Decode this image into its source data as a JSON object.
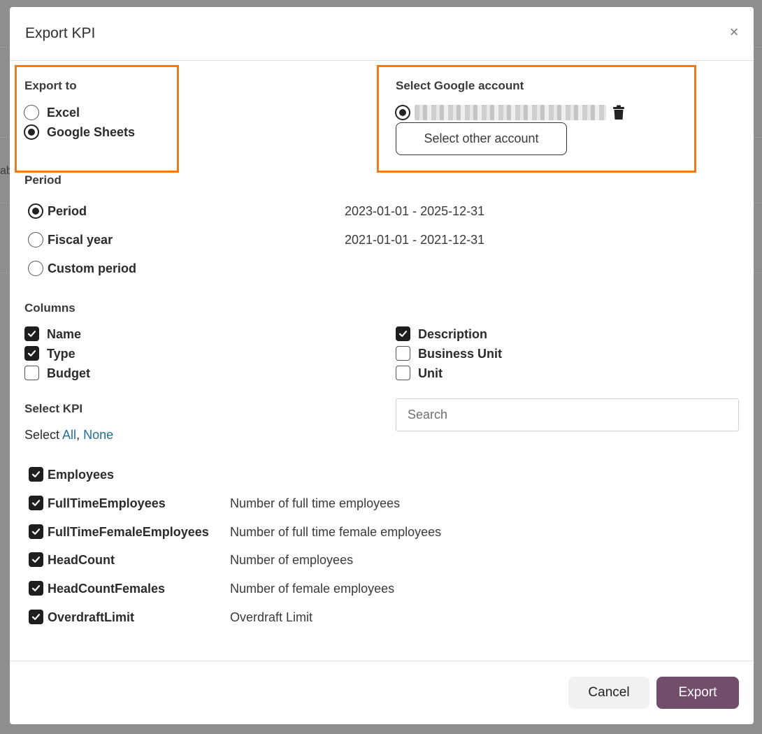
{
  "background": {
    "peek_text": "ab"
  },
  "modal": {
    "title": "Export KPI",
    "close_label": "×"
  },
  "export_to": {
    "title": "Export to",
    "options": [
      {
        "label": "Excel",
        "checked": false
      },
      {
        "label": "Google Sheets",
        "checked": true
      }
    ]
  },
  "google_account": {
    "title": "Select Google account",
    "account_checked": true,
    "trash_icon": "trash-icon",
    "other_account_label": "Select other account"
  },
  "period": {
    "title": "Period",
    "options": [
      {
        "label": "Period",
        "range": "2023-01-01 - 2025-12-31",
        "checked": true
      },
      {
        "label": "Fiscal year",
        "range": "2021-01-01 - 2021-12-31",
        "checked": false
      },
      {
        "label": "Custom period",
        "range": "",
        "checked": false
      }
    ]
  },
  "columns": {
    "title": "Columns",
    "left": [
      {
        "label": "Name",
        "checked": true
      },
      {
        "label": "Type",
        "checked": true
      },
      {
        "label": "Budget",
        "checked": false
      }
    ],
    "right": [
      {
        "label": "Description",
        "checked": true
      },
      {
        "label": "Business Unit",
        "checked": false
      },
      {
        "label": "Unit",
        "checked": false
      }
    ]
  },
  "select_kpi": {
    "title": "Select KPI",
    "select_prefix": "Select",
    "all_label": "All",
    "separator": ",",
    "none_label": "None",
    "search_placeholder": "Search",
    "items": [
      {
        "name": "Employees",
        "description": "",
        "checked": true
      },
      {
        "name": "FullTimeEmployees",
        "description": "Number of full time employees",
        "checked": true
      },
      {
        "name": "FullTimeFemaleEmployees",
        "description": "Number of full time female employees",
        "checked": true
      },
      {
        "name": "HeadCount",
        "description": "Number of employees",
        "checked": true
      },
      {
        "name": "HeadCountFemales",
        "description": "Number of female employees",
        "checked": true
      },
      {
        "name": "OverdraftLimit",
        "description": "Overdraft Limit",
        "checked": true
      }
    ]
  },
  "footer": {
    "cancel_label": "Cancel",
    "export_label": "Export"
  },
  "colors": {
    "highlight": "#f27a1a",
    "export_button": "#724d6c",
    "link": "#1f6f93"
  }
}
